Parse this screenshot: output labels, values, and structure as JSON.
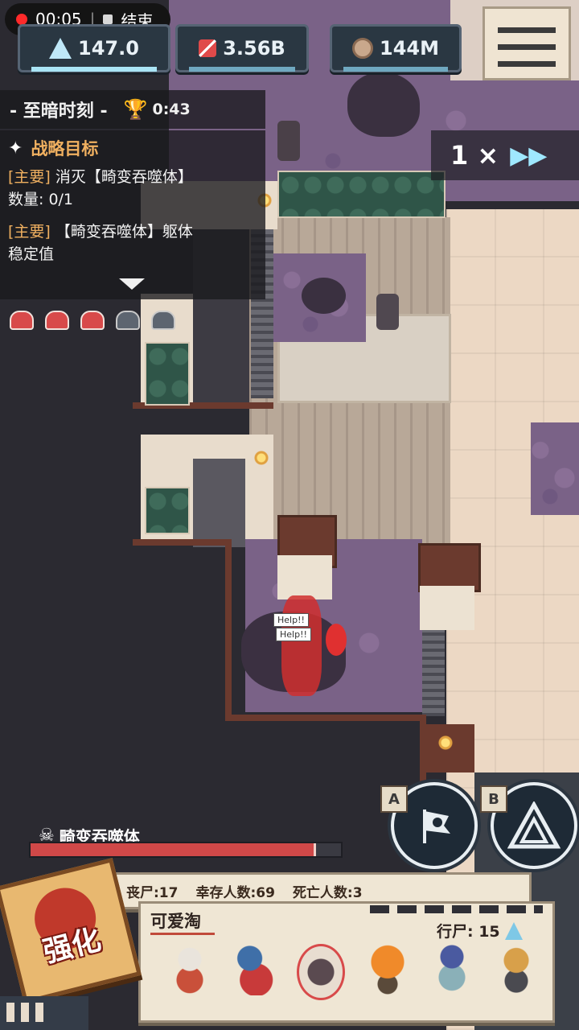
{
  "recording": {
    "time": "00:05",
    "stop_label": "结束"
  },
  "resources": [
    {
      "icon": "crystal-icon",
      "value": "147.0"
    },
    {
      "icon": "dna-icon",
      "value": "3.56B"
    },
    {
      "icon": "meat-icon",
      "value": "144M"
    }
  ],
  "event": {
    "title": "- 至暗时刻 -",
    "timer": "0:43"
  },
  "objectives": {
    "header": "战略目标",
    "items": [
      {
        "tag": "[主要]",
        "text": "消灭【畸变吞噬体】",
        "sub": "数量: 0/1"
      },
      {
        "tag": "[主要]",
        "text": "【畸变吞噬体】躯体",
        "sub": "稳定值"
      }
    ]
  },
  "speed": {
    "label": "1 ×"
  },
  "bubbles": {
    "help": "Help!!"
  },
  "boss": {
    "name": "畸变吞噬体",
    "hp_fraction": 0.92
  },
  "skills": [
    {
      "key": "A",
      "icon": "rally-flag-icon"
    },
    {
      "key": "B",
      "icon": "warning-triangle-icon"
    }
  ],
  "upgrade": {
    "label": "强化"
  },
  "stats": {
    "corpses": "丧尸:17",
    "survivors": "幸存人数:69",
    "dead": "死亡人数:3"
  },
  "squad": {
    "name": "可爱淘",
    "walker_count": "行尸: 15"
  },
  "colors": {
    "boss_hp": "#d04848",
    "purple_corruption": "#7a6287",
    "accent_cyan": "#a9e4f5"
  }
}
